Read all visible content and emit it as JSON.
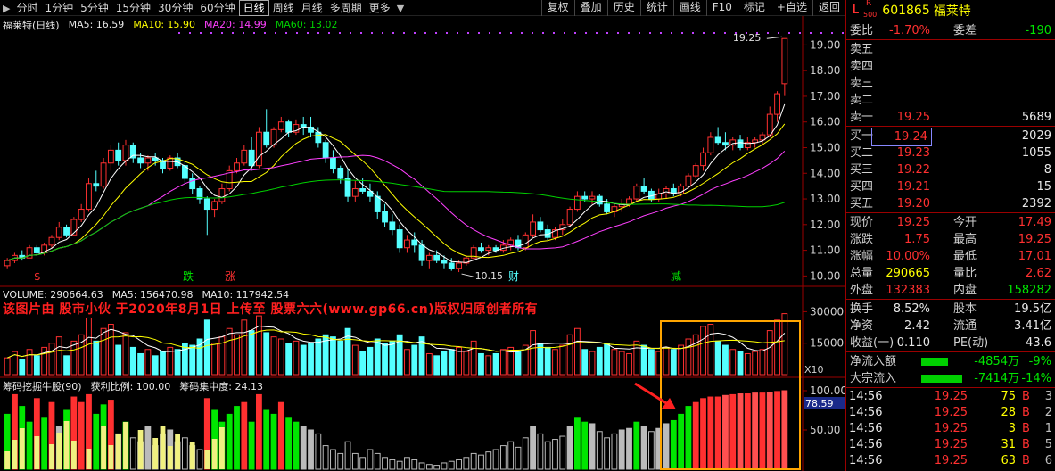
{
  "toolbar": {
    "periods": [
      "分时",
      "1分钟",
      "5分钟",
      "15分钟",
      "30分钟",
      "60分钟",
      "日线",
      "周线",
      "月线",
      "多周期",
      "更多"
    ],
    "active_period": "日线",
    "buttons": [
      "复权",
      "叠加",
      "历史",
      "统计",
      "画线",
      "F10",
      "标记",
      "+自选",
      "返回"
    ]
  },
  "kline_legend": {
    "title": "福莱特(日线)",
    "ma5": "MA5: 16.59",
    "ma10": "MA10: 15.90",
    "ma20": "MA20: 14.99",
    "ma60": "MA60: 13.02"
  },
  "volume_legend": {
    "volume": "VOLUME: 290664.63",
    "ma5": "MA5: 156470.98",
    "ma10": "MA10: 117942.54"
  },
  "chip_legend": {
    "name": "筹码挖掘牛股(90)",
    "profit_ratio": "获利比例: 100.00",
    "concentration": "筹码集中度: 24.13"
  },
  "watermark": "该图片由 股市小伙 于2020年8月1日 上传至 股票六六(www.gp66.cn)版权归原创者所有",
  "price_axis": [
    "19.00",
    "18.00",
    "17.00",
    "16.00",
    "15.00",
    "14.00",
    "13.00",
    "12.00",
    "11.00",
    "10.00"
  ],
  "volume_axis": [
    "30000",
    "15000"
  ],
  "volume_unit": "X10",
  "chip_axis": [
    "100.00",
    "50.00"
  ],
  "chip_marker": "78.59",
  "annotations": {
    "high": "19.25",
    "low": "10.15",
    "signals": [
      "$",
      "跌",
      "涨",
      "财",
      "减"
    ]
  },
  "colors": {
    "up": "#ff3030",
    "down": "#54ffff",
    "ma5": "#ffffff",
    "ma10": "#ffff00",
    "ma20": "#ff40ff",
    "ma60": "#00d000",
    "highlight": "#ffa500"
  },
  "stock": {
    "badge": "L",
    "r_badge": "R",
    "r_sub": "500",
    "code": "601865",
    "name": "福莱特"
  },
  "quote": {
    "weibi_label": "委比",
    "weibi_value": "-1.70%",
    "weicha_label": "委差",
    "weicha_value": "-190",
    "sell": [
      {
        "label": "卖五",
        "price": "",
        "vol": ""
      },
      {
        "label": "卖四",
        "price": "",
        "vol": ""
      },
      {
        "label": "卖三",
        "price": "",
        "vol": ""
      },
      {
        "label": "卖二",
        "price": "",
        "vol": ""
      },
      {
        "label": "卖一",
        "price": "19.25",
        "vol": "5689"
      }
    ],
    "buy": [
      {
        "label": "买一",
        "price": "19.24",
        "vol": "2029"
      },
      {
        "label": "买二",
        "price": "19.23",
        "vol": "1055"
      },
      {
        "label": "买三",
        "price": "19.22",
        "vol": "8"
      },
      {
        "label": "买四",
        "price": "19.21",
        "vol": "15"
      },
      {
        "label": "买五",
        "price": "19.20",
        "vol": "2392"
      }
    ],
    "stats": [
      {
        "l1": "现价",
        "v1": "19.25",
        "c1": "red",
        "l2": "今开",
        "v2": "17.49",
        "c2": "red"
      },
      {
        "l1": "涨跌",
        "v1": "1.75",
        "c1": "red",
        "l2": "最高",
        "v2": "19.25",
        "c2": "red"
      },
      {
        "l1": "涨幅",
        "v1": "10.00%",
        "c1": "red",
        "l2": "最低",
        "v2": "17.01",
        "c2": "red"
      },
      {
        "l1": "总量",
        "v1": "290665",
        "c1": "yellow",
        "l2": "量比",
        "v2": "2.62",
        "c2": "red"
      },
      {
        "l1": "外盘",
        "v1": "132383",
        "c1": "red",
        "l2": "内盘",
        "v2": "158282",
        "c2": "green"
      }
    ],
    "stats2": [
      {
        "l1": "换手",
        "v1": "8.52%",
        "c1": "white",
        "l2": "股本",
        "v2": "19.5亿",
        "c2": "white"
      },
      {
        "l1": "净资",
        "v1": "2.42",
        "c1": "white",
        "l2": "流通",
        "v2": "3.41亿",
        "c2": "white"
      },
      {
        "l1": "收益(一)",
        "v1": "0.110",
        "c1": "white",
        "l2": "PE(动)",
        "v2": "43.6",
        "c2": "white"
      }
    ],
    "flows": [
      {
        "label": "净流入额",
        "value": "-4854万",
        "pct": "-9%",
        "bar": 0.45
      },
      {
        "label": "大宗流入",
        "value": "-7414万",
        "pct": "-14%",
        "bar": 0.7
      }
    ]
  },
  "ticks": [
    {
      "time": "14:56",
      "price": "19.25",
      "vol": "75",
      "bs": "B",
      "n": "3"
    },
    {
      "time": "14:56",
      "price": "19.25",
      "vol": "28",
      "bs": "B",
      "n": "2"
    },
    {
      "time": "14:56",
      "price": "19.25",
      "vol": "3",
      "bs": "B",
      "n": "1"
    },
    {
      "time": "14:56",
      "price": "19.25",
      "vol": "31",
      "bs": "B",
      "n": "5"
    },
    {
      "time": "14:56",
      "price": "19.25",
      "vol": "63",
      "bs": "B",
      "n": "6"
    }
  ],
  "chart_data": {
    "type": "candlestick",
    "title": "福莱特(日线)",
    "ylim": [
      9.7,
      19.5
    ],
    "candles": [
      [
        10.4,
        10.7,
        10.3,
        10.6
      ],
      [
        10.6,
        10.9,
        10.5,
        10.8
      ],
      [
        10.8,
        11.0,
        10.6,
        10.7
      ],
      [
        10.7,
        11.2,
        10.7,
        11.1
      ],
      [
        11.1,
        11.2,
        10.8,
        10.9
      ],
      [
        10.9,
        11.3,
        10.8,
        11.2
      ],
      [
        11.2,
        11.6,
        11.1,
        11.5
      ],
      [
        11.5,
        12.1,
        11.4,
        11.9
      ],
      [
        11.9,
        12.0,
        11.5,
        11.6
      ],
      [
        11.6,
        12.3,
        11.6,
        12.2
      ],
      [
        12.2,
        12.8,
        12.1,
        12.6
      ],
      [
        12.6,
        13.8,
        12.5,
        13.6
      ],
      [
        13.6,
        14.1,
        13.3,
        13.5
      ],
      [
        13.5,
        14.6,
        13.4,
        14.4
      ],
      [
        14.4,
        15.1,
        14.1,
        14.9
      ],
      [
        14.9,
        15.2,
        14.3,
        14.5
      ],
      [
        14.5,
        15.3,
        14.3,
        15.1
      ],
      [
        15.1,
        15.2,
        14.4,
        14.6
      ],
      [
        14.6,
        14.8,
        14.2,
        14.4
      ],
      [
        14.4,
        14.7,
        14.1,
        14.6
      ],
      [
        14.6,
        14.8,
        14.3,
        14.5
      ],
      [
        14.5,
        14.6,
        14.0,
        14.2
      ],
      [
        14.2,
        14.7,
        14.1,
        14.6
      ],
      [
        14.6,
        14.8,
        14.2,
        14.3
      ],
      [
        14.3,
        14.5,
        13.6,
        13.8
      ],
      [
        13.8,
        14.0,
        13.2,
        13.4
      ],
      [
        13.4,
        13.5,
        12.8,
        13.0
      ],
      [
        13.0,
        13.1,
        11.6,
        12.6
      ],
      [
        12.6,
        13.0,
        12.3,
        12.9
      ],
      [
        12.9,
        13.6,
        12.8,
        13.4
      ],
      [
        13.4,
        14.3,
        13.3,
        14.1
      ],
      [
        14.1,
        14.6,
        14.0,
        14.4
      ],
      [
        14.4,
        15.1,
        14.3,
        14.9
      ],
      [
        14.9,
        15.4,
        14.1,
        14.3
      ],
      [
        14.3,
        15.8,
        14.2,
        15.6
      ],
      [
        15.6,
        16.5,
        15.0,
        15.1
      ],
      [
        15.1,
        15.8,
        15.0,
        15.7
      ],
      [
        15.7,
        16.2,
        15.6,
        16.0
      ],
      [
        16.0,
        16.1,
        15.4,
        15.6
      ],
      [
        15.6,
        16.1,
        15.5,
        15.9
      ],
      [
        15.9,
        16.2,
        15.5,
        15.8
      ],
      [
        15.8,
        16.2,
        15.4,
        15.6
      ],
      [
        15.6,
        15.8,
        15.0,
        15.2
      ],
      [
        15.2,
        15.3,
        14.4,
        14.6
      ],
      [
        14.6,
        14.9,
        14.0,
        14.2
      ],
      [
        14.2,
        14.3,
        13.6,
        13.8
      ],
      [
        13.8,
        14.2,
        12.9,
        13.1
      ],
      [
        13.1,
        13.7,
        12.9,
        13.4
      ],
      [
        13.4,
        13.8,
        13.2,
        13.3
      ],
      [
        13.3,
        13.6,
        12.9,
        13.1
      ],
      [
        13.1,
        13.3,
        12.2,
        12.5
      ],
      [
        12.5,
        12.8,
        11.9,
        12.1
      ],
      [
        12.1,
        12.4,
        11.6,
        11.8
      ],
      [
        11.8,
        12.0,
        10.9,
        11.1
      ],
      [
        11.1,
        11.6,
        10.9,
        11.4
      ],
      [
        11.4,
        11.7,
        10.9,
        11.2
      ],
      [
        11.2,
        11.4,
        10.4,
        10.6
      ],
      [
        10.6,
        10.9,
        10.3,
        10.8
      ],
      [
        10.8,
        11.0,
        10.5,
        10.6
      ],
      [
        10.6,
        10.8,
        10.3,
        10.5
      ],
      [
        10.5,
        10.7,
        10.2,
        10.3
      ],
      [
        10.3,
        10.6,
        10.15,
        10.5
      ],
      [
        10.5,
        10.8,
        10.4,
        10.7
      ],
      [
        10.7,
        11.2,
        10.6,
        11.1
      ],
      [
        11.1,
        11.3,
        10.9,
        11.0
      ],
      [
        11.0,
        11.2,
        10.8,
        11.1
      ],
      [
        11.1,
        11.2,
        10.9,
        11.0
      ],
      [
        11.0,
        11.4,
        10.9,
        11.2
      ],
      [
        11.2,
        11.5,
        11.0,
        11.4
      ],
      [
        11.4,
        11.6,
        11.0,
        11.1
      ],
      [
        11.1,
        11.7,
        11.0,
        11.6
      ],
      [
        11.6,
        12.4,
        11.5,
        12.1
      ],
      [
        12.1,
        12.3,
        11.7,
        11.8
      ],
      [
        11.8,
        12.0,
        11.4,
        11.5
      ],
      [
        11.5,
        11.9,
        11.4,
        11.8
      ],
      [
        11.8,
        12.2,
        11.6,
        12.0
      ],
      [
        12.0,
        12.7,
        11.9,
        12.6
      ],
      [
        12.6,
        13.3,
        12.5,
        13.1
      ],
      [
        13.1,
        13.3,
        12.9,
        13.0
      ],
      [
        13.0,
        13.3,
        12.8,
        13.1
      ],
      [
        13.1,
        13.2,
        12.7,
        12.8
      ],
      [
        12.8,
        13.0,
        12.4,
        12.5
      ],
      [
        12.5,
        12.8,
        12.3,
        12.7
      ],
      [
        12.7,
        13.0,
        12.5,
        12.8
      ],
      [
        12.8,
        13.1,
        12.7,
        13.0
      ],
      [
        13.0,
        13.6,
        12.9,
        13.5
      ],
      [
        13.5,
        13.8,
        13.2,
        13.3
      ],
      [
        13.3,
        13.4,
        12.9,
        13.0
      ],
      [
        13.0,
        13.4,
        12.9,
        13.2
      ],
      [
        13.2,
        13.5,
        13.0,
        13.4
      ],
      [
        13.4,
        13.6,
        13.1,
        13.2
      ],
      [
        13.2,
        13.6,
        13.1,
        13.5
      ],
      [
        13.5,
        14.0,
        13.4,
        13.9
      ],
      [
        13.9,
        14.4,
        13.8,
        14.3
      ],
      [
        14.3,
        15.0,
        14.1,
        14.8
      ],
      [
        14.8,
        15.6,
        14.7,
        15.4
      ],
      [
        15.4,
        15.8,
        15.1,
        15.2
      ],
      [
        15.2,
        15.6,
        14.9,
        15.1
      ],
      [
        15.1,
        15.4,
        14.9,
        15.3
      ],
      [
        15.3,
        15.5,
        14.9,
        15.0
      ],
      [
        15.0,
        15.4,
        14.9,
        15.2
      ],
      [
        15.2,
        15.4,
        15.0,
        15.3
      ],
      [
        15.3,
        15.6,
        15.1,
        15.5
      ],
      [
        15.5,
        16.6,
        15.4,
        16.3
      ],
      [
        16.3,
        17.2,
        16.0,
        17.1
      ],
      [
        17.49,
        19.25,
        17.01,
        19.25
      ]
    ],
    "ma_lines": [
      {
        "name": "MA5",
        "color": "#ffffff",
        "period": 5
      },
      {
        "name": "MA10",
        "color": "#ffff00",
        "period": 10
      },
      {
        "name": "MA20",
        "color": "#ff40ff",
        "period": 20
      },
      {
        "name": "MA60",
        "color": "#00d000",
        "period": 60
      }
    ],
    "volume_ylim": [
      0,
      34000
    ],
    "volumes": [
      8000,
      11000,
      7000,
      12000,
      9000,
      13000,
      15000,
      18000,
      9000,
      16000,
      19000,
      27000,
      16000,
      22000,
      24000,
      14000,
      20000,
      13000,
      10000,
      12000,
      9000,
      11000,
      13000,
      12000,
      15000,
      14000,
      17000,
      26000,
      15000,
      18000,
      22000,
      19000,
      26000,
      21000,
      28000,
      20000,
      18000,
      17000,
      15000,
      16000,
      14000,
      15000,
      17000,
      19000,
      18000,
      16000,
      22000,
      14000,
      11000,
      13000,
      17000,
      15000,
      16000,
      19000,
      12000,
      14000,
      18000,
      10000,
      9000,
      11000,
      12000,
      13000,
      11000,
      16000,
      10000,
      9000,
      10000,
      12000,
      13000,
      11000,
      14000,
      21000,
      15000,
      13000,
      12000,
      14000,
      19000,
      22000,
      12000,
      11000,
      13000,
      15000,
      12000,
      11000,
      10000,
      16000,
      14000,
      12000,
      11000,
      13000,
      12000,
      14000,
      17000,
      19000,
      23000,
      24000,
      16000,
      14000,
      12000,
      11000,
      10000,
      11000,
      12000,
      21000,
      26000,
      29066
    ],
    "chip_ylim": [
      0,
      100
    ],
    "chip_values": [
      70,
      95,
      80,
      60,
      90,
      65,
      85,
      55,
      75,
      92,
      85,
      95,
      70,
      82,
      88,
      45,
      60,
      40,
      35,
      55,
      30,
      45,
      50,
      35,
      40,
      30,
      25,
      90,
      75,
      60,
      70,
      80,
      85,
      60,
      95,
      75,
      70,
      85,
      65,
      60,
      55,
      50,
      45,
      30,
      25,
      20,
      35,
      20,
      15,
      25,
      20,
      15,
      12,
      10,
      15,
      12,
      8,
      6,
      5,
      8,
      10,
      12,
      15,
      20,
      18,
      22,
      25,
      30,
      35,
      28,
      40,
      55,
      45,
      35,
      38,
      42,
      55,
      65,
      60,
      58,
      48,
      40,
      45,
      50,
      52,
      60,
      55,
      48,
      52,
      58,
      62,
      70,
      80,
      85,
      90,
      92,
      92,
      94,
      95,
      96,
      96,
      97,
      97,
      98,
      99,
      100
    ],
    "signals": [
      {
        "i": 7,
        "text": "$",
        "color": "#ff3030"
      },
      {
        "i": 35,
        "text": "跌",
        "color": "#00e600"
      },
      {
        "i": 44,
        "text": "涨",
        "color": "#ff3030"
      },
      {
        "i": 101,
        "text": "财",
        "color": "#54ffff"
      },
      {
        "i": 135,
        "text": "减",
        "color": "#00e600"
      }
    ]
  }
}
